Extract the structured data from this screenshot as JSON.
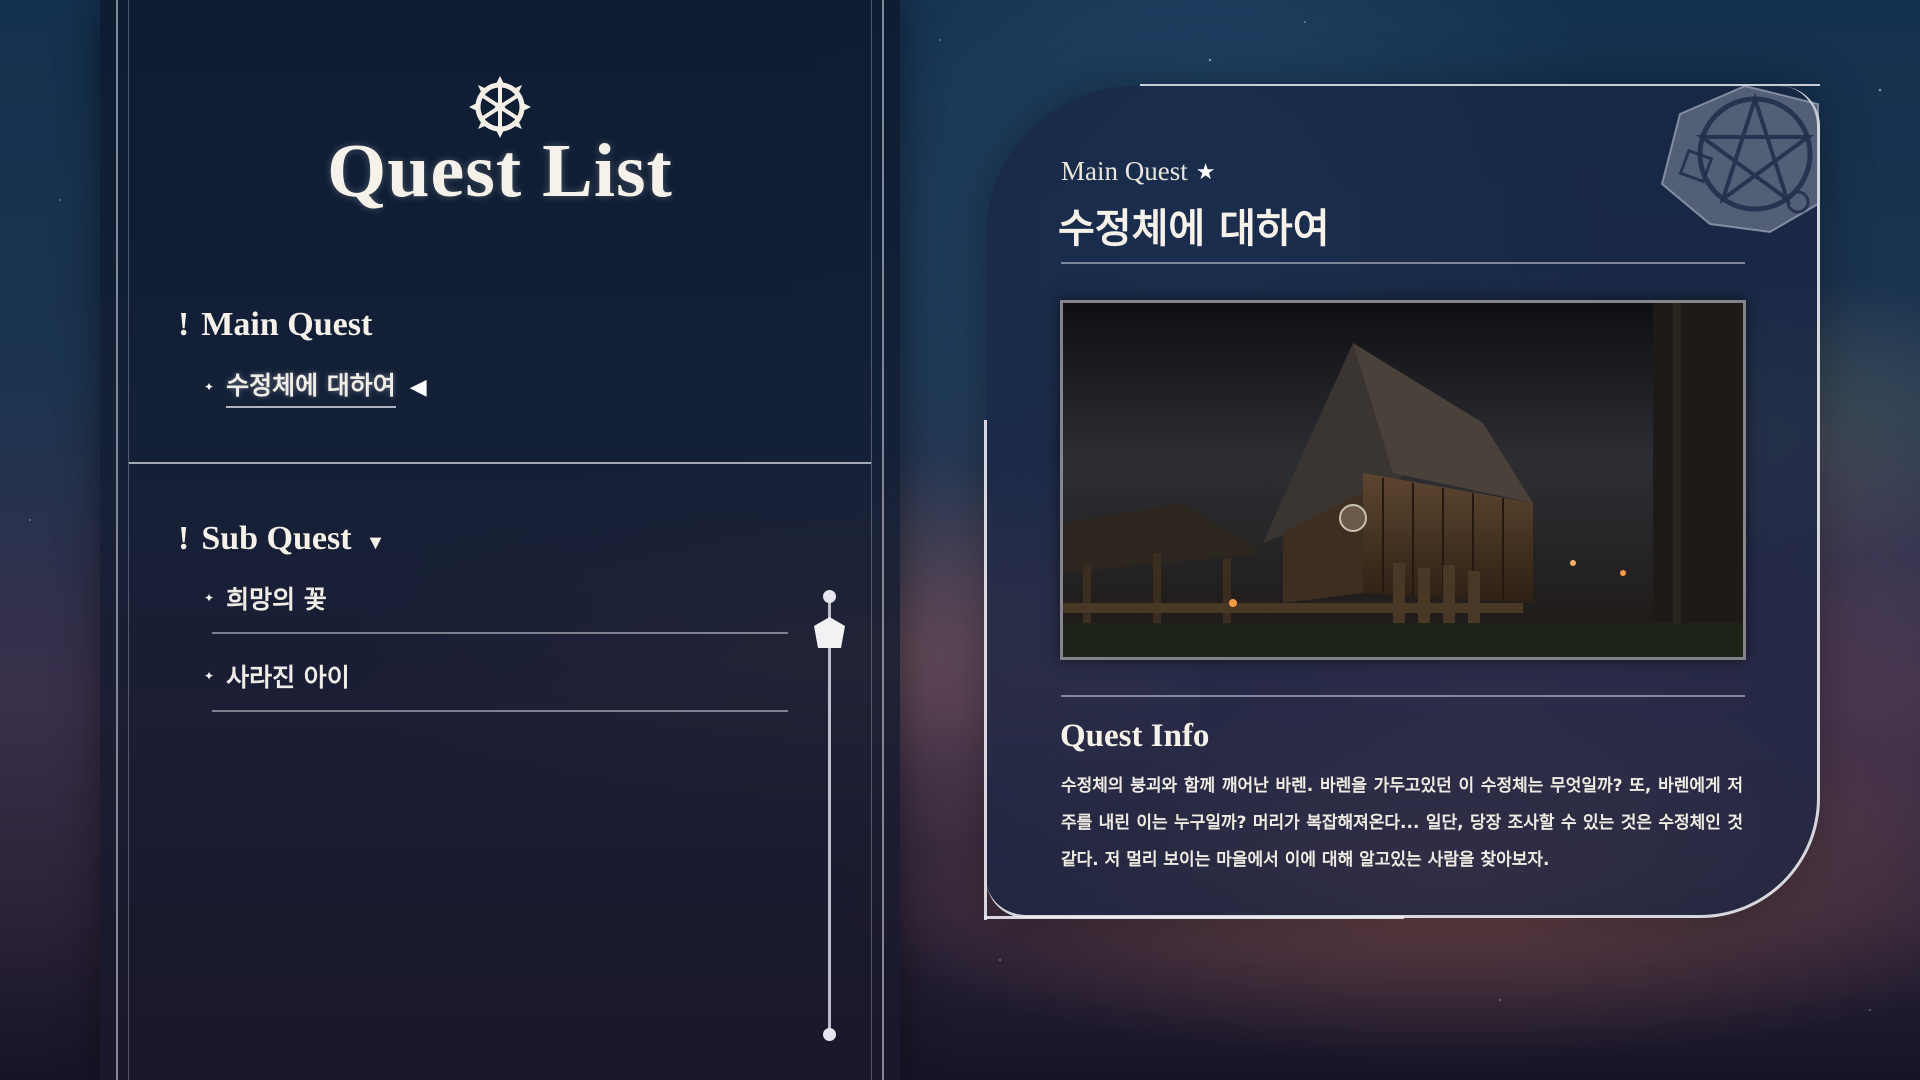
{
  "quest_list": {
    "title": "Quest List",
    "emblem_icon": "compass-wheel-icon",
    "main_section": {
      "title": "Main Quest",
      "marker": "!",
      "items": [
        {
          "label": "수정체에 대하여",
          "selected": true
        }
      ]
    },
    "sub_section": {
      "title": "Sub Quest",
      "marker": "!",
      "expand_icon": "triangle-down-icon",
      "items": [
        {
          "label": "희망의 꽃",
          "selected": false
        },
        {
          "label": "사라진 아이",
          "selected": false
        }
      ]
    },
    "scroll_position": 0.05
  },
  "quest_detail": {
    "kicker": "Main Quest",
    "kicker_icon": "star-icon",
    "title": "수정체에 대하여",
    "seal_icon": "pentagram-seal-icon",
    "image": "viking-longhouse-night-scene",
    "info_title": "Quest Info",
    "info_body": "수정체의 붕괴와 함께 깨어난 바렌. 바렌을 가두고있던 이 수정체는 무엇일까? 또, 바렌에게 저주를 내린 이는 누구일까? 머리가 복잡해져온다... 일단, 당장 조사할 수 있는 것은 수정체인 것 같다. 저 멀리 보이는 마을에서 이에 대해 알고있는 사람을 찾아보자."
  },
  "colors": {
    "panel": "#0d1b30",
    "text": "#f6f2ea",
    "rule": "#d2d2dc",
    "frame": "#ebebf0"
  }
}
